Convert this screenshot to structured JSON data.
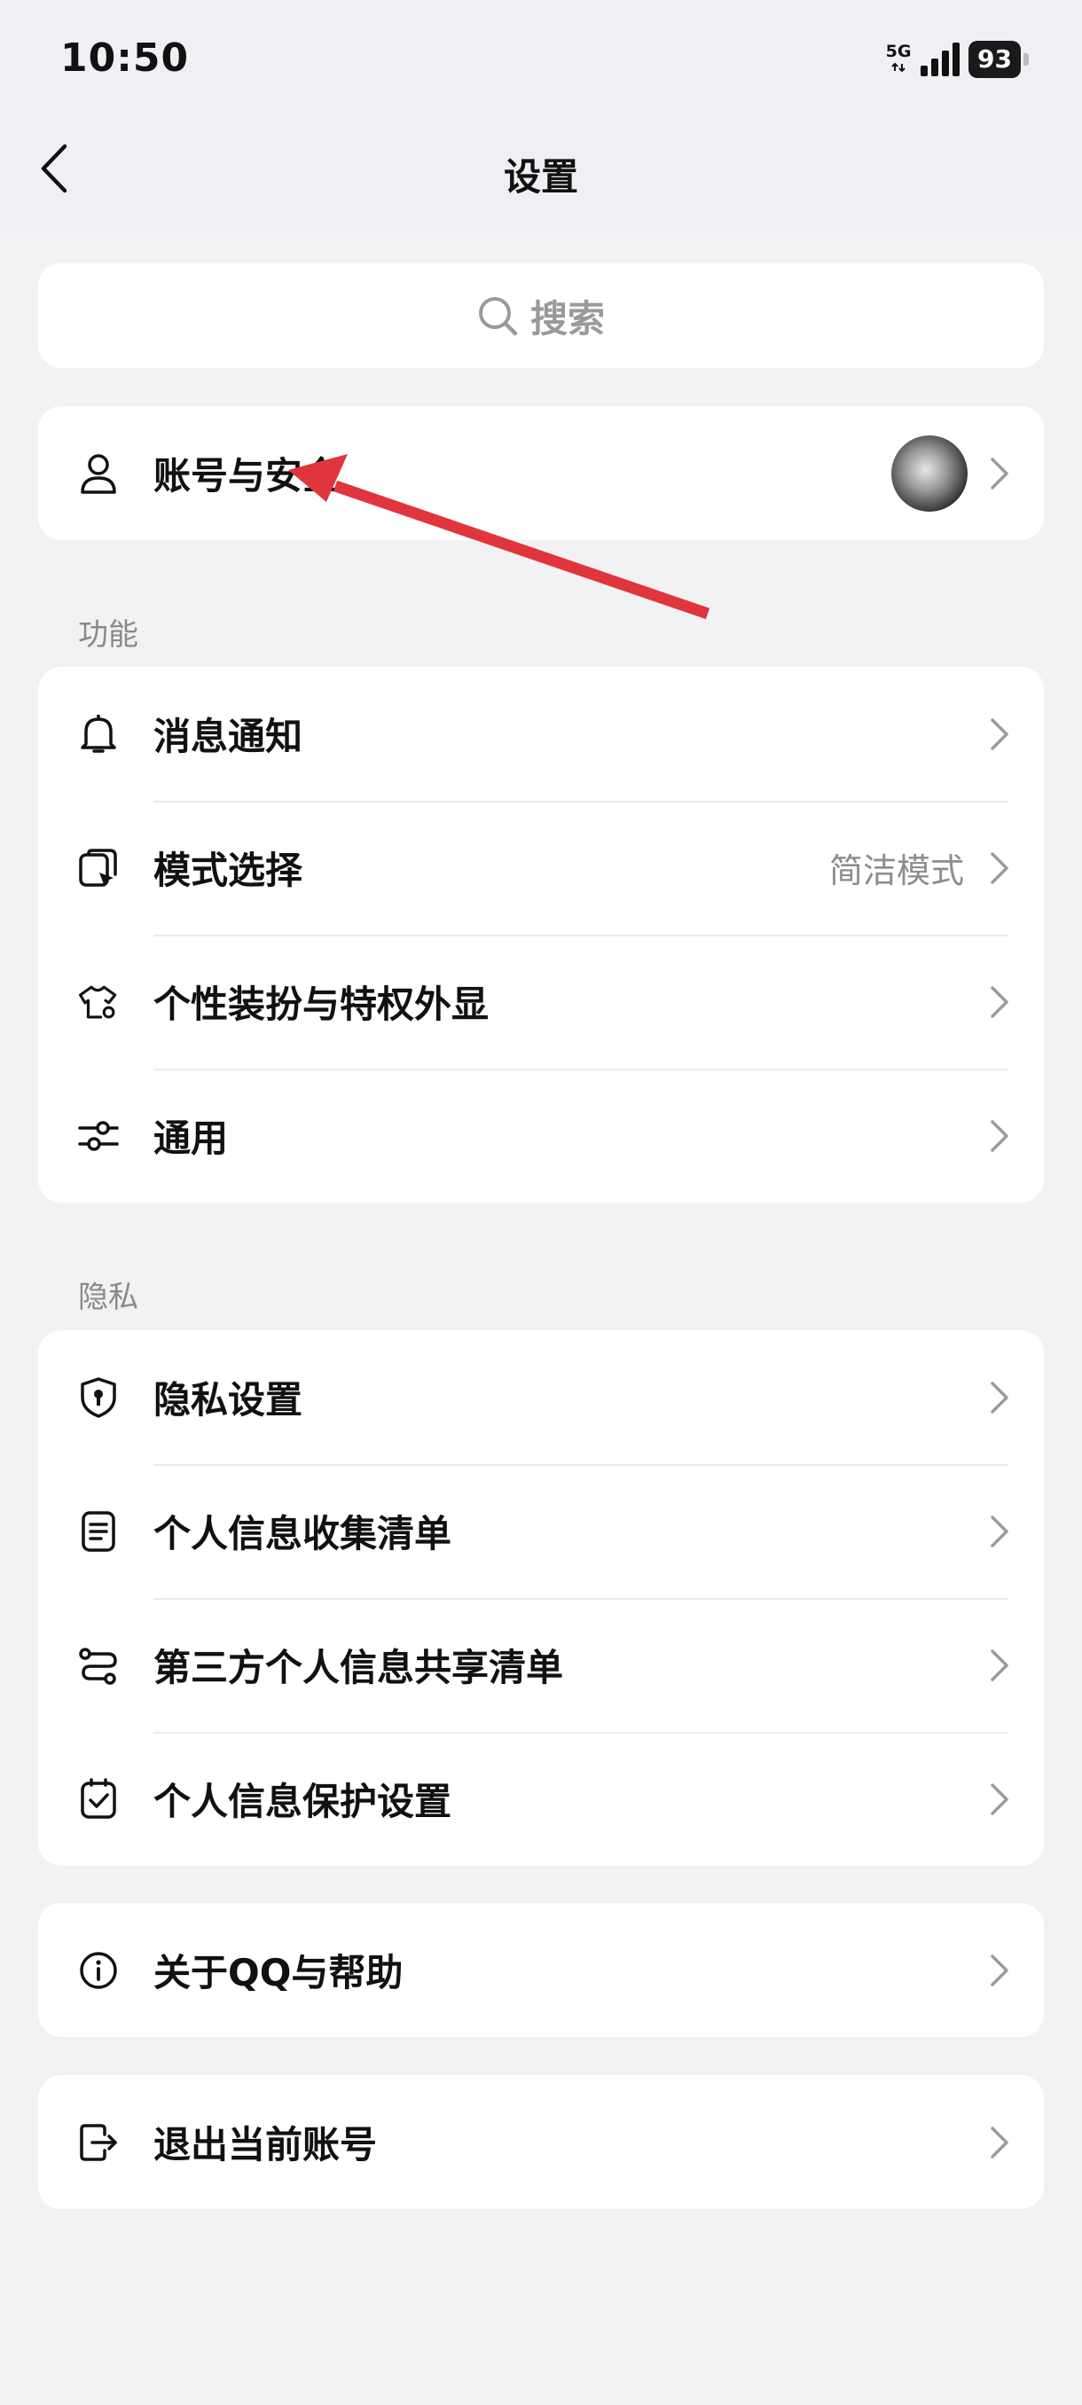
{
  "status_bar": {
    "time": "10:50",
    "network": "5G",
    "battery": "93"
  },
  "nav": {
    "title": "设置"
  },
  "search": {
    "placeholder": "搜索"
  },
  "account": {
    "label": "账号与安全"
  },
  "sections": {
    "features": {
      "title": "功能",
      "items": [
        {
          "label": "消息通知",
          "icon": "bell-icon"
        },
        {
          "label": "模式选择",
          "value": "简洁模式",
          "icon": "mode-icon"
        },
        {
          "label": "个性装扮与特权外显",
          "icon": "tshirt-icon"
        },
        {
          "label": "通用",
          "icon": "sliders-icon"
        }
      ]
    },
    "privacy": {
      "title": "隐私",
      "items": [
        {
          "label": "隐私设置",
          "icon": "shield-icon"
        },
        {
          "label": "个人信息收集清单",
          "icon": "document-icon"
        },
        {
          "label": "第三方个人信息共享清单",
          "icon": "share-icon"
        },
        {
          "label": "个人信息保护设置",
          "icon": "checkbox-icon"
        }
      ]
    }
  },
  "about": {
    "label": "关于QQ与帮助",
    "icon": "info-icon"
  },
  "logout": {
    "label": "退出当前账号",
    "icon": "logout-icon"
  },
  "colors": {
    "background": "#f2f2f4",
    "card": "#ffffff",
    "annotation_arrow": "#e0353d"
  }
}
